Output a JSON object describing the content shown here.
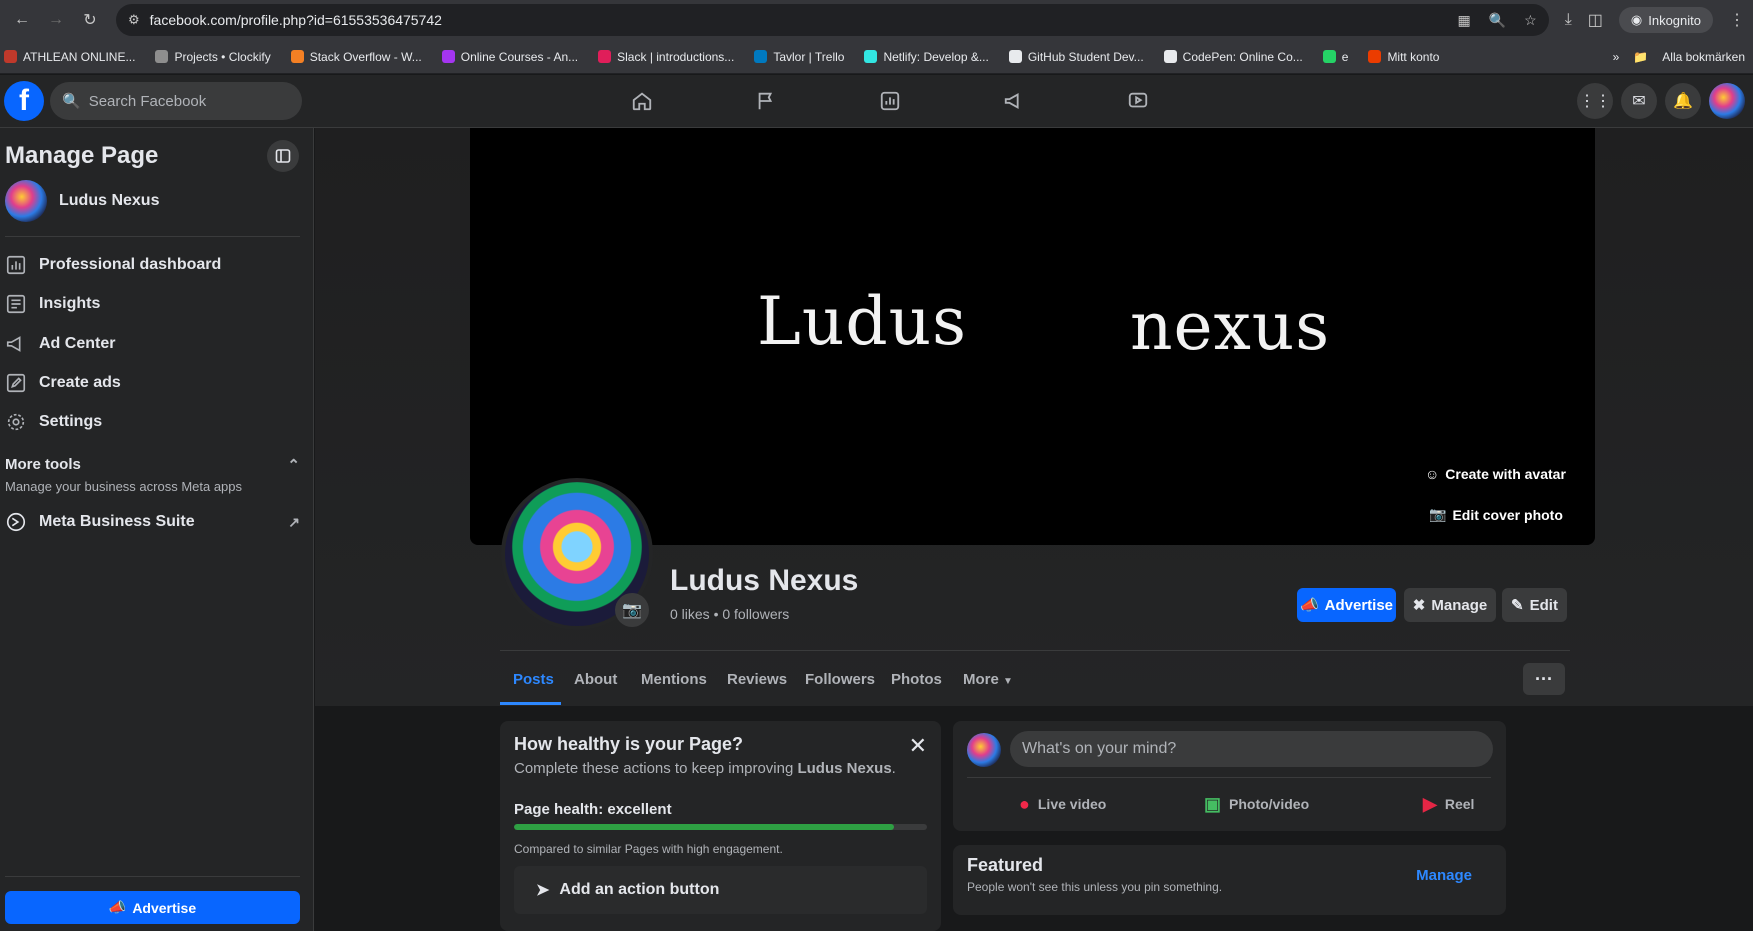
{
  "browser": {
    "url": "facebook.com/profile.php?id=61553536475742",
    "incognito_label": "Inkognito",
    "bookmarks": [
      {
        "label": "ATHLEAN ONLINE...",
        "color": "#c0392b"
      },
      {
        "label": "Projects • Clockify",
        "color": "#8e8e8e"
      },
      {
        "label": "Stack Overflow - W...",
        "color": "#f48024"
      },
      {
        "label": "Online Courses - An...",
        "color": "#a435f0"
      },
      {
        "label": "Slack | introductions...",
        "color": "#e01e5a"
      },
      {
        "label": "Tavlor | Trello",
        "color": "#0079bf"
      },
      {
        "label": "Netlify: Develop &...",
        "color": "#32e6e2"
      },
      {
        "label": "GitHub Student Dev...",
        "color": "#e8eaed"
      },
      {
        "label": "CodePen: Online Co...",
        "color": "#e8eaed"
      },
      {
        "label": "e",
        "color": "#25d366"
      },
      {
        "label": "Mitt konto",
        "color": "#eb3c00"
      }
    ],
    "bookmarks_overflow": "»",
    "all_bookmarks": "Alla bokmärken"
  },
  "fb": {
    "search_placeholder": "Search Facebook"
  },
  "sidebar": {
    "title": "Manage Page",
    "page_name": "Ludus Nexus",
    "items": [
      {
        "label": "Professional dashboard"
      },
      {
        "label": "Insights"
      },
      {
        "label": "Ad Center"
      },
      {
        "label": "Create ads"
      },
      {
        "label": "Settings"
      }
    ],
    "more_tools_title": "More tools",
    "more_tools_sub": "Manage your business across Meta apps",
    "meta_suite": "Meta Business Suite",
    "advertise_label": "Advertise"
  },
  "cover": {
    "word1": "Ludus",
    "word2": "nexus",
    "create_avatar": "Create with avatar",
    "edit_cover": "Edit cover photo"
  },
  "profile": {
    "name": "Ludus Nexus",
    "stats": "0 likes • 0 followers",
    "advertise": "Advertise",
    "manage": "Manage",
    "edit": "Edit",
    "tabs": [
      "Posts",
      "About",
      "Mentions",
      "Reviews",
      "Followers",
      "Photos",
      "More"
    ]
  },
  "health": {
    "title": "How healthy is your Page?",
    "sub_prefix": "Complete these actions to keep improving ",
    "sub_page": "Ludus Nexus",
    "sub_suffix": ".",
    "label": "Page health: excellent",
    "progress": 0.92,
    "note": "Compared to similar Pages with high engagement.",
    "action": "Add an action button"
  },
  "composer": {
    "placeholder": "What's on your mind?",
    "live": "Live video",
    "photo": "Photo/video",
    "reel": "Reel"
  },
  "featured": {
    "title": "Featured",
    "sub": "People won't see this unless you pin something.",
    "manage": "Manage"
  },
  "colors": {
    "brand": "#0866ff",
    "link": "#2d88ff",
    "health": "#2ea043"
  }
}
